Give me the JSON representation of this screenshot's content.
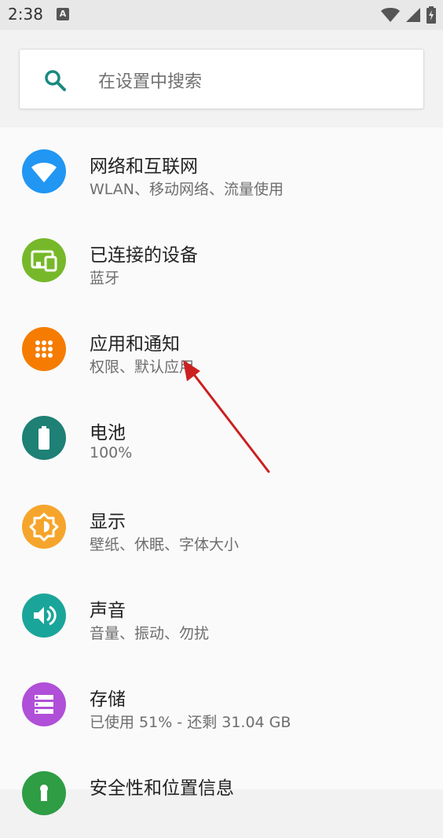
{
  "status_bar": {
    "time": "2:38",
    "notification_icon": "A"
  },
  "search": {
    "placeholder": "在设置中搜索"
  },
  "colors": {
    "network": "#2196f3",
    "devices": "#76b82a",
    "apps": "#f57c00",
    "battery": "#1f8075",
    "display": "#f6a52c",
    "sound": "#1aa59a",
    "storage": "#b04fd8",
    "security": "#2e9d44"
  },
  "settings": {
    "items": [
      {
        "title": "网络和互联网",
        "subtitle": "WLAN、移动网络、流量使用",
        "icon": "wifi-icon"
      },
      {
        "title": "已连接的设备",
        "subtitle": "蓝牙",
        "icon": "devices-icon"
      },
      {
        "title": "应用和通知",
        "subtitle": "权限、默认应用",
        "icon": "apps-grid-icon"
      },
      {
        "title": "电池",
        "subtitle": "100%",
        "icon": "battery-icon"
      },
      {
        "title": "显示",
        "subtitle": "壁纸、休眠、字体大小",
        "icon": "brightness-icon"
      },
      {
        "title": "声音",
        "subtitle": "音量、振动、勿扰",
        "icon": "volume-icon"
      },
      {
        "title": "存储",
        "subtitle": "已使用 51% - 还剩 31.04 GB",
        "icon": "storage-icon"
      },
      {
        "title": "安全性和位置信息",
        "subtitle": "",
        "icon": "lock-icon"
      }
    ]
  }
}
